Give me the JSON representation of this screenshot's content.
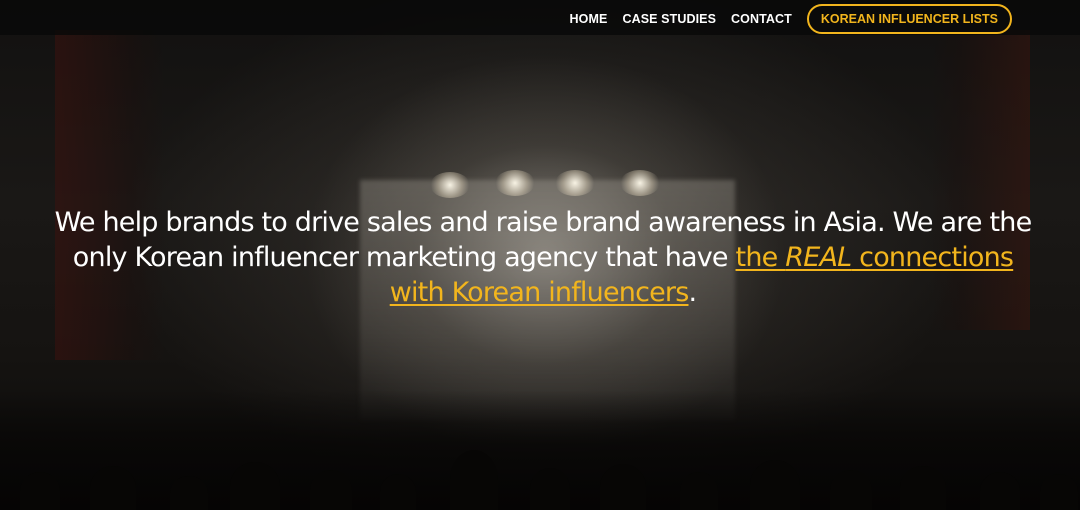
{
  "nav": {
    "links": [
      "HOME",
      "CASE STUDIES",
      "CONTACT"
    ],
    "cta_label": "KOREAN INFLUENCER LISTS",
    "accent_color": "#f2b51d"
  },
  "hero": {
    "text_before": "We help brands to drive sales and raise brand awareness in Asia. We are the only Korean influencer marketing agency that have ",
    "link_part1": "the ",
    "link_emphasis": "REAL",
    "link_part2": " connections with Korean influencers",
    "text_after": "."
  }
}
